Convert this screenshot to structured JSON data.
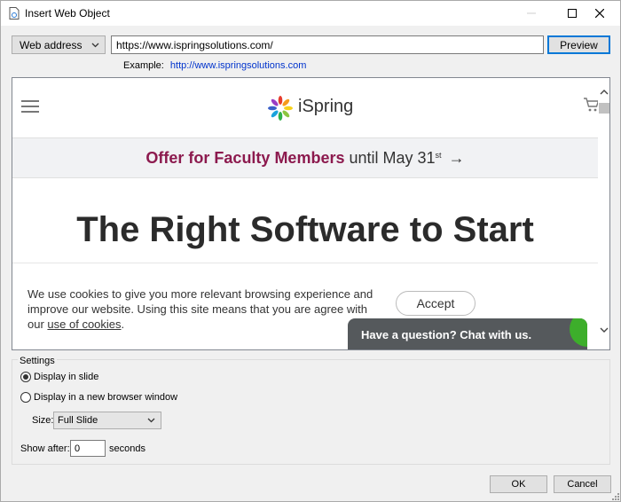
{
  "window": {
    "title": "Insert Web Object"
  },
  "source": {
    "type_selected": "Web address",
    "url_value": "https://www.ispringsolutions.com/",
    "preview_label": "Preview",
    "example_label": "Example:",
    "example_url": "http://www.ispringsolutions.com"
  },
  "webpage": {
    "logo_text": "iSpring",
    "banner_offer": "Offer for Faculty Members",
    "banner_rest": "until May 31",
    "banner_sup": "st",
    "banner_arrow": "→",
    "hero_title": "The Right Software to Start",
    "cookie_text": "We use cookies to give you more relevant browsing experience and improve our website. Using this site means that you are agree with our",
    "cookie_link": "use of cookies",
    "cookie_end": ".",
    "accept_label": "Accept",
    "chat_label": "Have a question? Chat with us."
  },
  "settings": {
    "group_label": "Settings",
    "display_in_slide": "Display in slide",
    "display_new_window": "Display in a new browser window",
    "size_label": "Size:",
    "size_value": "Full Slide",
    "show_after_label": "Show after:",
    "show_after_value": "0",
    "seconds_label": "seconds"
  },
  "footer": {
    "ok_label": "OK",
    "cancel_label": "Cancel"
  },
  "colors": {
    "accent": "#0078d7",
    "offer": "#8c1a4e",
    "chat_bg": "#55595c",
    "chat_badge": "#3dae2b"
  }
}
